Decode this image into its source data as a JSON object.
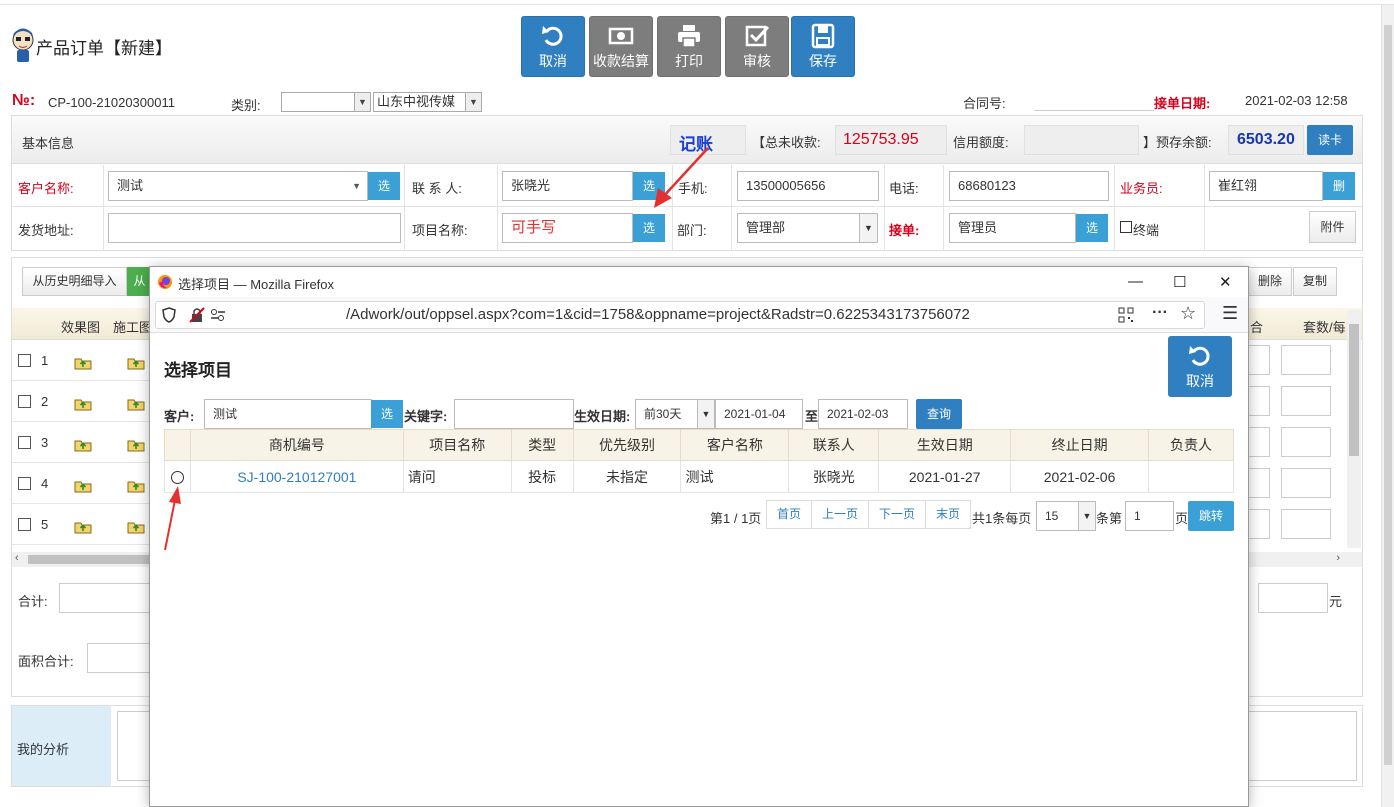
{
  "page": {
    "title": "产品订单【新建】"
  },
  "toolbar": {
    "cancel": "取消",
    "settle": "收款结算",
    "print": "打印",
    "audit": "审核",
    "save": "保存"
  },
  "order": {
    "no_label": "№:",
    "no_value": "CP-100-21020300011",
    "category_label": "类别:",
    "category_value": "",
    "company_value": "山东中视传媒",
    "contract_label": "合同号:",
    "date_label": "接单日期:",
    "date_value": "2021-02-03 12:58"
  },
  "info": {
    "section_title": "基本信息",
    "bookkeeping": "记账",
    "total_unpaid_label": "【总未收款:",
    "total_unpaid_value": "125753.95",
    "credit_label": "信用额度:",
    "prepaid_label": "】预存余额:",
    "prepaid_value": "6503.20",
    "read_card": "读卡",
    "customer_label": "客户名称:",
    "customer_value": "测试",
    "contact_label": "联 系 人:",
    "contact_value": "张晓光",
    "mobile_label": "手机:",
    "mobile_value": "13500005656",
    "phone_label": "电话:",
    "phone_value": "68680123",
    "salesman_label": "业务员:",
    "salesman_value": "崔红翎",
    "salesman_btn": "删",
    "address_label": "发货地址:",
    "address_value": "",
    "project_label": "项目名称:",
    "project_value": "可手写",
    "dept_label": "部门:",
    "dept_value": "管理部",
    "receiver_label": "接单:",
    "receiver_value": "管理员",
    "terminal_label": "终端",
    "attach": "附件",
    "select_btn": "选"
  },
  "grid": {
    "import_history": "从历史明细导入",
    "import_green": "从",
    "delete": "删除",
    "copy": "复制",
    "col_effect": "效果图",
    "col_construct": "施工图",
    "col_sets": "套数/每",
    "col_partial": "合",
    "rows": [
      "1",
      "2",
      "3",
      "4",
      "5"
    ],
    "sum_label": "合计:",
    "area_label": "面积合计:",
    "yuan": "元"
  },
  "analysis": {
    "label": "我的分析"
  },
  "popup": {
    "window_title": "选择项目 — Mozilla Firefox",
    "url": "/Adwork/out/oppsel.aspx?com=1&cid=1758&oppname=project&Radstr=0.6225343173756072",
    "dialog_title": "选择项目",
    "cancel": "取消",
    "customer_label": "客户:",
    "customer_value": "测试",
    "select_btn": "选",
    "keyword_label": "关键字:",
    "keyword_value": "",
    "date_label": "生效日期:",
    "range_value": "前30天",
    "date_from": "2021-01-04",
    "to_label": "至",
    "date_to": "2021-02-03",
    "query": "查询",
    "headers": [
      "商机编号",
      "项目名称",
      "类型",
      "优先级别",
      "客户名称",
      "联系人",
      "生效日期",
      "终止日期",
      "负责人"
    ],
    "row": [
      "SJ-100-210127001",
      "请问",
      "投标",
      "未指定",
      "测试",
      "张晓光",
      "2021-01-27",
      "2021-02-06",
      ""
    ],
    "page_info": "第1 / 1页",
    "first": "首页",
    "prev": "上一页",
    "next": "下一页",
    "last": "末页",
    "total_info": "共1条每页",
    "page_size": "15",
    "goto_label": "条第",
    "goto_value": "1",
    "page_suffix": "页",
    "jump": "跳转"
  },
  "colors": {
    "primary_blue": "#2f7fc1",
    "select_blue": "#3ba0d6",
    "red_label": "#d9001b",
    "gray_button": "#7d7d7d",
    "green_button": "#4cae4c"
  }
}
